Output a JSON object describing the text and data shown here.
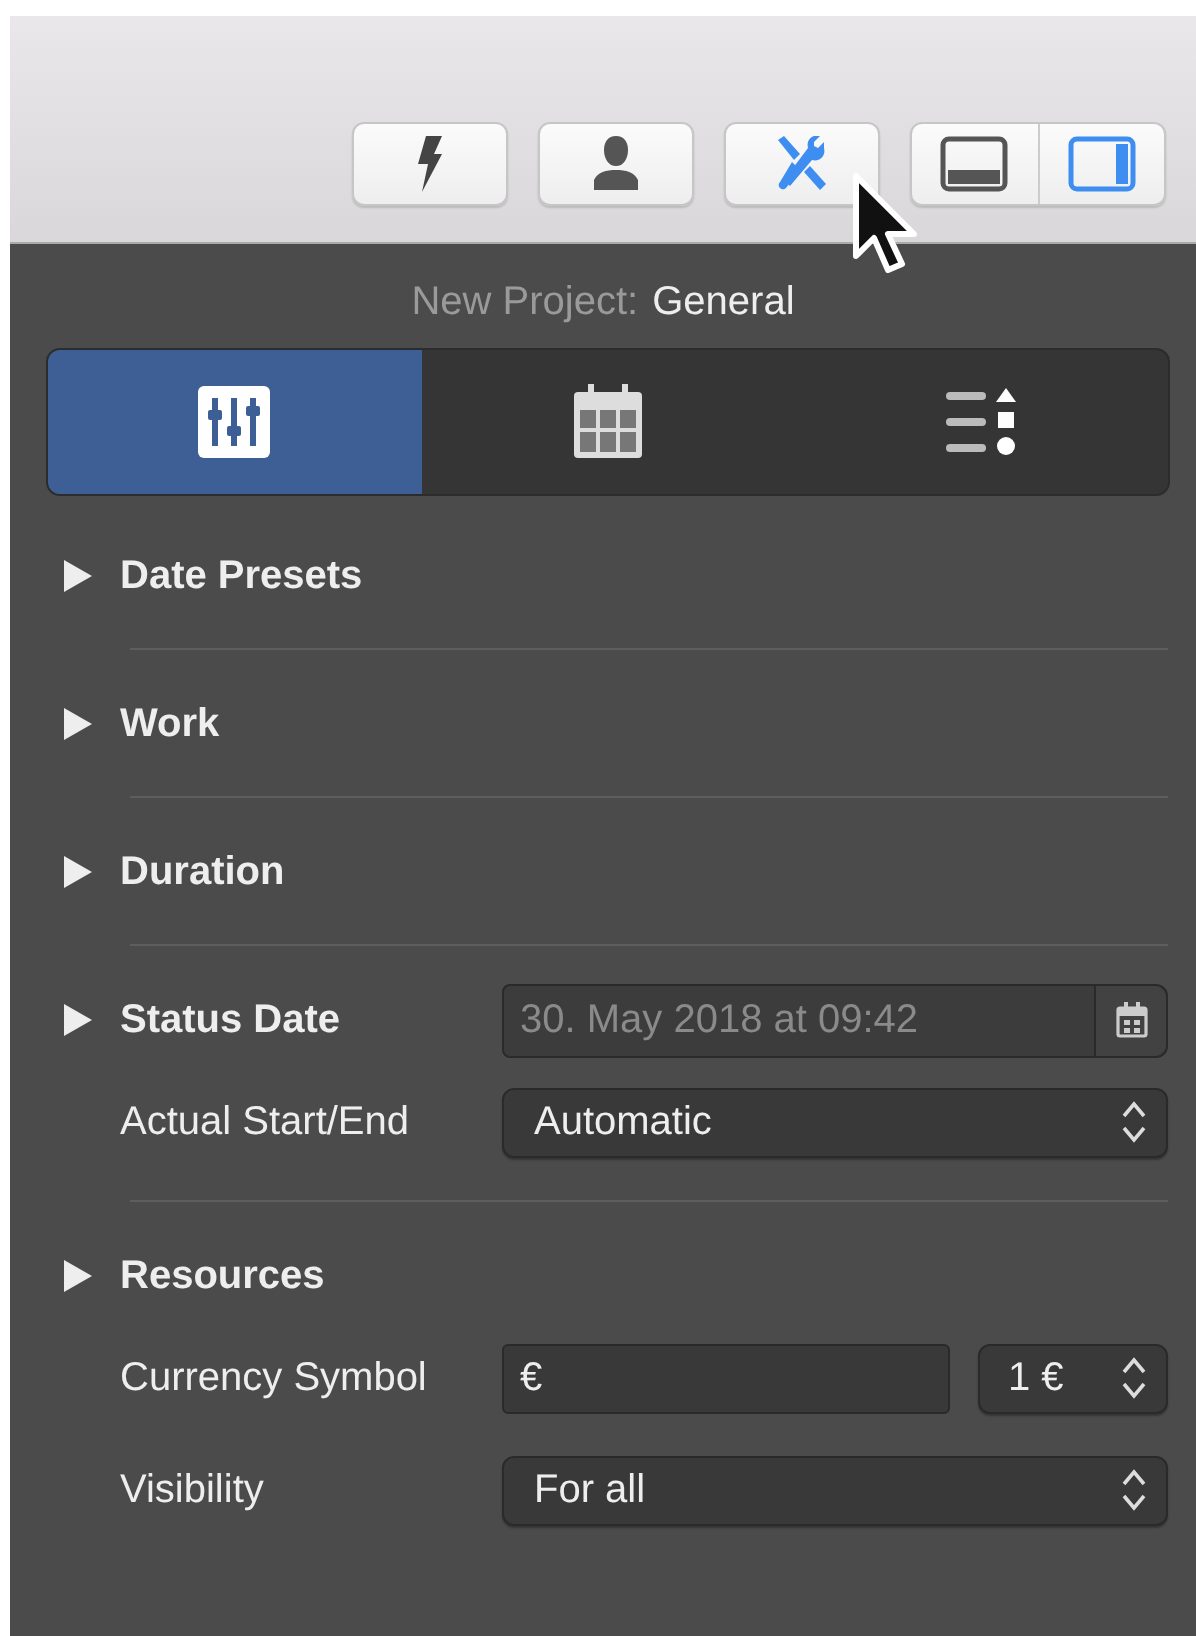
{
  "toolbar": {
    "buttons": [
      {
        "selected": false
      },
      {
        "selected": false
      },
      {
        "selected": true
      }
    ],
    "view_toggle": [
      {
        "selected": false
      },
      {
        "selected": true
      }
    ]
  },
  "inspector": {
    "title_prefix": "New Project:",
    "title": "General",
    "tabs": [
      {
        "selected": true
      },
      {
        "selected": false
      },
      {
        "selected": false
      }
    ],
    "rows": [
      {
        "kind": "section",
        "label": "Date Presets",
        "expanded": false
      },
      {
        "kind": "section",
        "label": "Work",
        "expanded": false
      },
      {
        "kind": "section",
        "label": "Duration",
        "expanded": false
      },
      {
        "kind": "section",
        "label": "Status Date",
        "expanded": false,
        "date": {
          "value": "30. May 2018 at 09:42",
          "disabled": true
        }
      },
      {
        "kind": "popup",
        "label": "Actual Start/End",
        "value": "Automatic"
      },
      {
        "kind": "section",
        "label": "Resources",
        "expanded": false
      },
      {
        "kind": "currency",
        "label": "Currency Symbol",
        "value": "€",
        "unit": "1 €"
      },
      {
        "kind": "popup",
        "label": "Visibility",
        "value": "For all"
      }
    ]
  }
}
